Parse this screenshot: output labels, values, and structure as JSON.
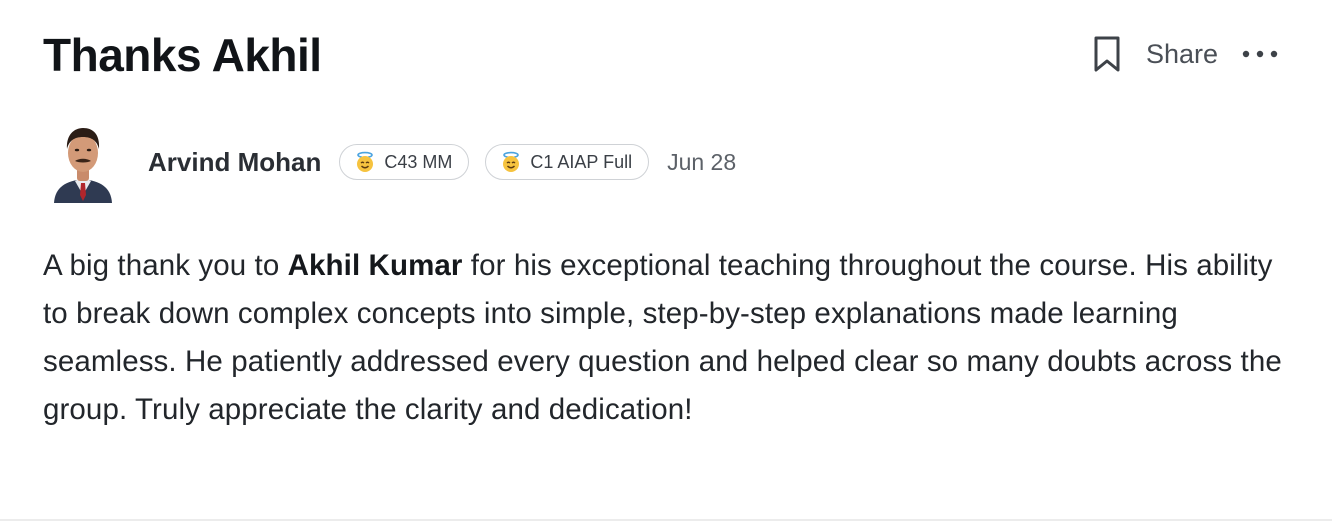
{
  "post": {
    "title": "Thanks Akhil",
    "actions": {
      "bookmark_icon": "bookmark-icon",
      "share_label": "Share",
      "more_icon": "more-horizontal-icon"
    },
    "author": {
      "name": "Arvind Mohan",
      "badges": [
        {
          "emoji": "smiling-face-with-halo",
          "label": "C43 MM"
        },
        {
          "emoji": "smiling-face-with-halo",
          "label": "C1 AIAP Full"
        }
      ],
      "date": "Jun 28"
    },
    "body": {
      "before": "A big thank you to ",
      "highlight": "Akhil Kumar",
      "after": " for his exceptional teaching throughout the course. His ability to break down complex concepts into simple, step-by-step explanations made learning seamless. He patiently addressed every question and helped clear so many doubts across the group. Truly appreciate the clarity and dedication!"
    }
  },
  "colors": {
    "title": "#111418",
    "text": "#22262b",
    "muted": "#5c6168",
    "badge_border": "#cfd2d6",
    "divider": "#ececec"
  }
}
